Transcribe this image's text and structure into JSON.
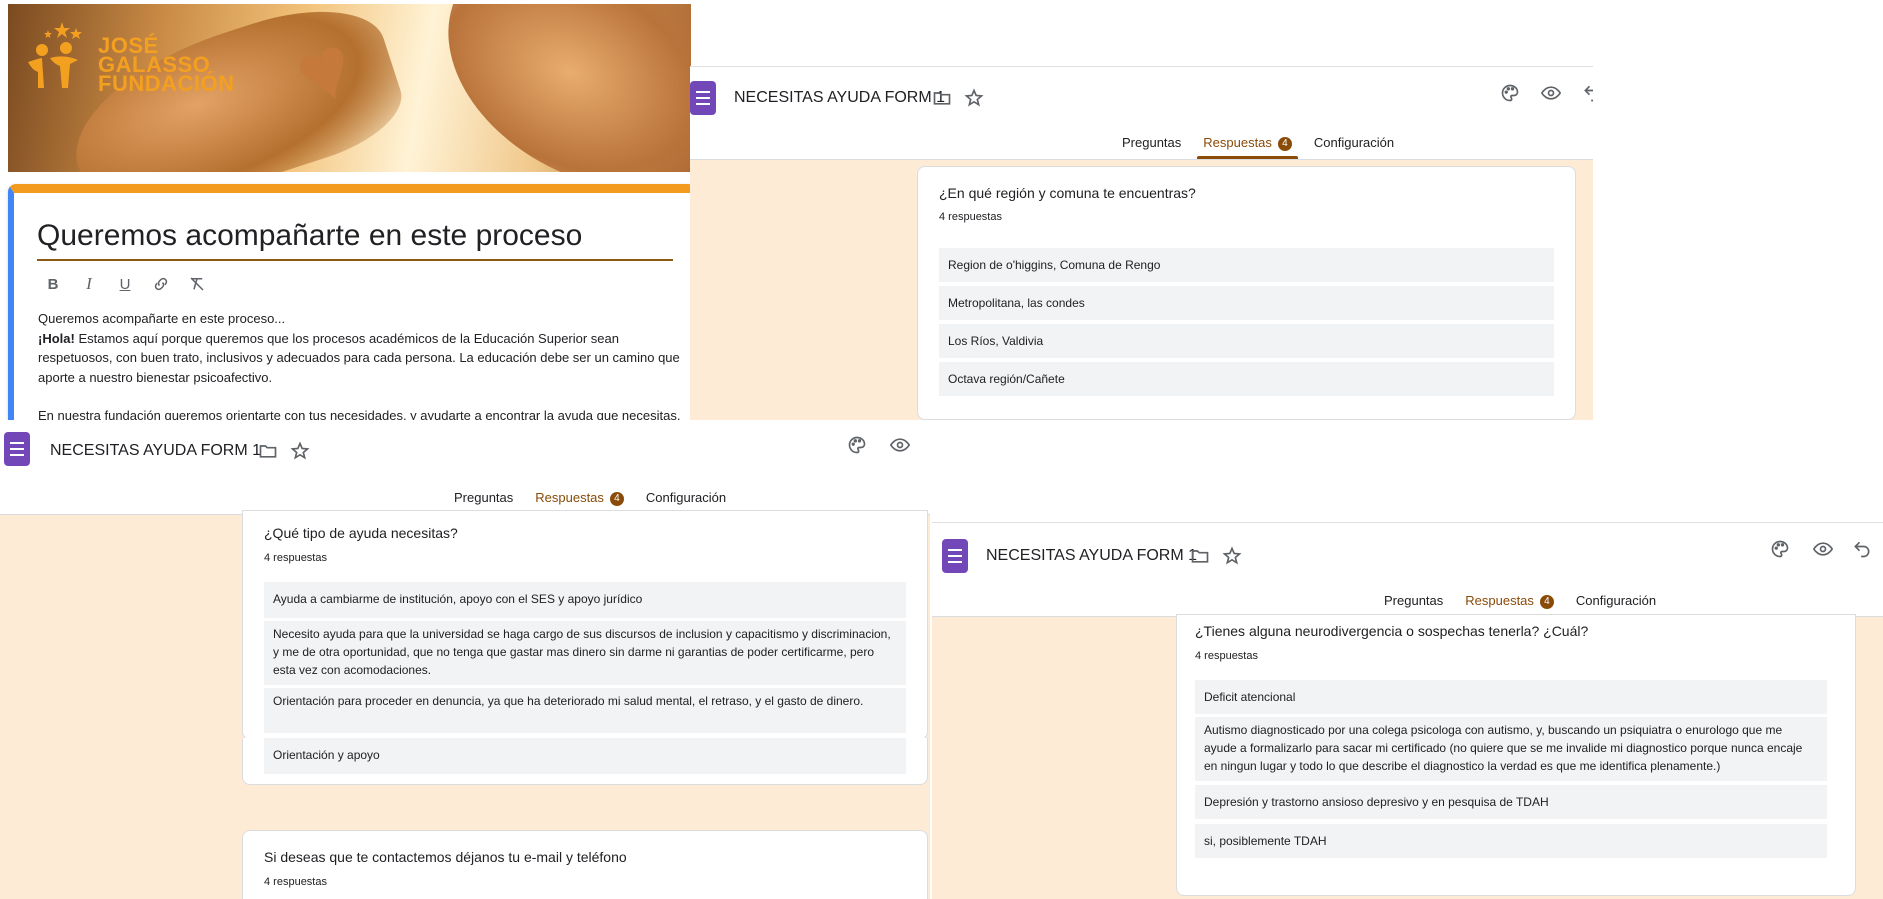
{
  "editor": {
    "logo": [
      "JOSÉ",
      "GALASSO",
      "FUNDACIÓN"
    ],
    "title": "Queremos acompañarte en este proceso",
    "toolbar": [
      "B",
      "I",
      "U",
      "link",
      "clear"
    ],
    "body": {
      "line1": "Queremos acompañarte en este proceso...",
      "hola": "¡Hola!",
      "para1": " Estamos aquí porque queremos que los procesos académicos de la Educación Superior sean respetuosos, con buen trato, inclusivos y adecuados para cada persona. La educación debe ser un camino que aporte a nuestro bienestar psicoafectivo.",
      "para2": "En nuestra fundación queremos orientarte con tus necesidades, y ayudarte a encontrar la ayuda que necesitas."
    }
  },
  "form": {
    "title": "NECESITAS AYUDA FORM 1",
    "tabs": {
      "questions": "Preguntas",
      "responses": "Respuestas",
      "count": "4",
      "settings": "Configuración"
    },
    "accent": "#8a4b08",
    "icons": [
      "forms-icon",
      "folder-icon",
      "star-icon",
      "palette-icon",
      "eye-icon",
      "undo-icon"
    ]
  },
  "panelTop": {
    "question": "¿En qué región y comuna te encuentras?",
    "count": "4 respuestas",
    "responses": [
      "Region de o'higgins, Comuna de Rengo",
      "Metropolitana, las condes",
      "Los Ríos, Valdivia",
      "Octava región/Cañete"
    ]
  },
  "panelLeft": {
    "question": "¿Qué tipo de ayuda necesitas?",
    "count": "4 respuestas",
    "responses": [
      "Ayuda a cambiarme de institución, apoyo con el SES y apoyo jurídico",
      "Necesito ayuda para que la universidad se haga cargo de sus discursos de inclusion y capacitismo y discriminacion, y me de otra oportunidad, que no tenga que gastar mas dinero sin darme ni garantias de poder certificarme, pero esta vez con acomodaciones.",
      "Orientación para proceder en denuncia, ya que ha deteriorado mi salud mental, el retraso, y el gasto de dinero.",
      "Orientación y apoyo"
    ],
    "question2": "Si deseas que te contactemos déjanos tu e-mail y teléfono",
    "count2": "4 respuestas"
  },
  "panelRight": {
    "question": "¿Tienes alguna neurodivergencia o sospechas tenerla? ¿Cuál?",
    "count": "4 respuestas",
    "responses": [
      "Deficit atencional",
      "Autismo diagnosticado por una colega psicologa con autismo, y, buscando un psiquiatra o enurologo que me ayude a formalizarlo para sacar mi certificado (no quiere que se me invalide mi diagnostico porque nunca encaje en ningun lugar y todo lo que describe el diagnostico la verdad es que me identifica plenamente.)",
      "Depresión y trastorno ansioso depresivo y en pesquisa de TDAH",
      "si, posiblemente TDAH"
    ]
  }
}
